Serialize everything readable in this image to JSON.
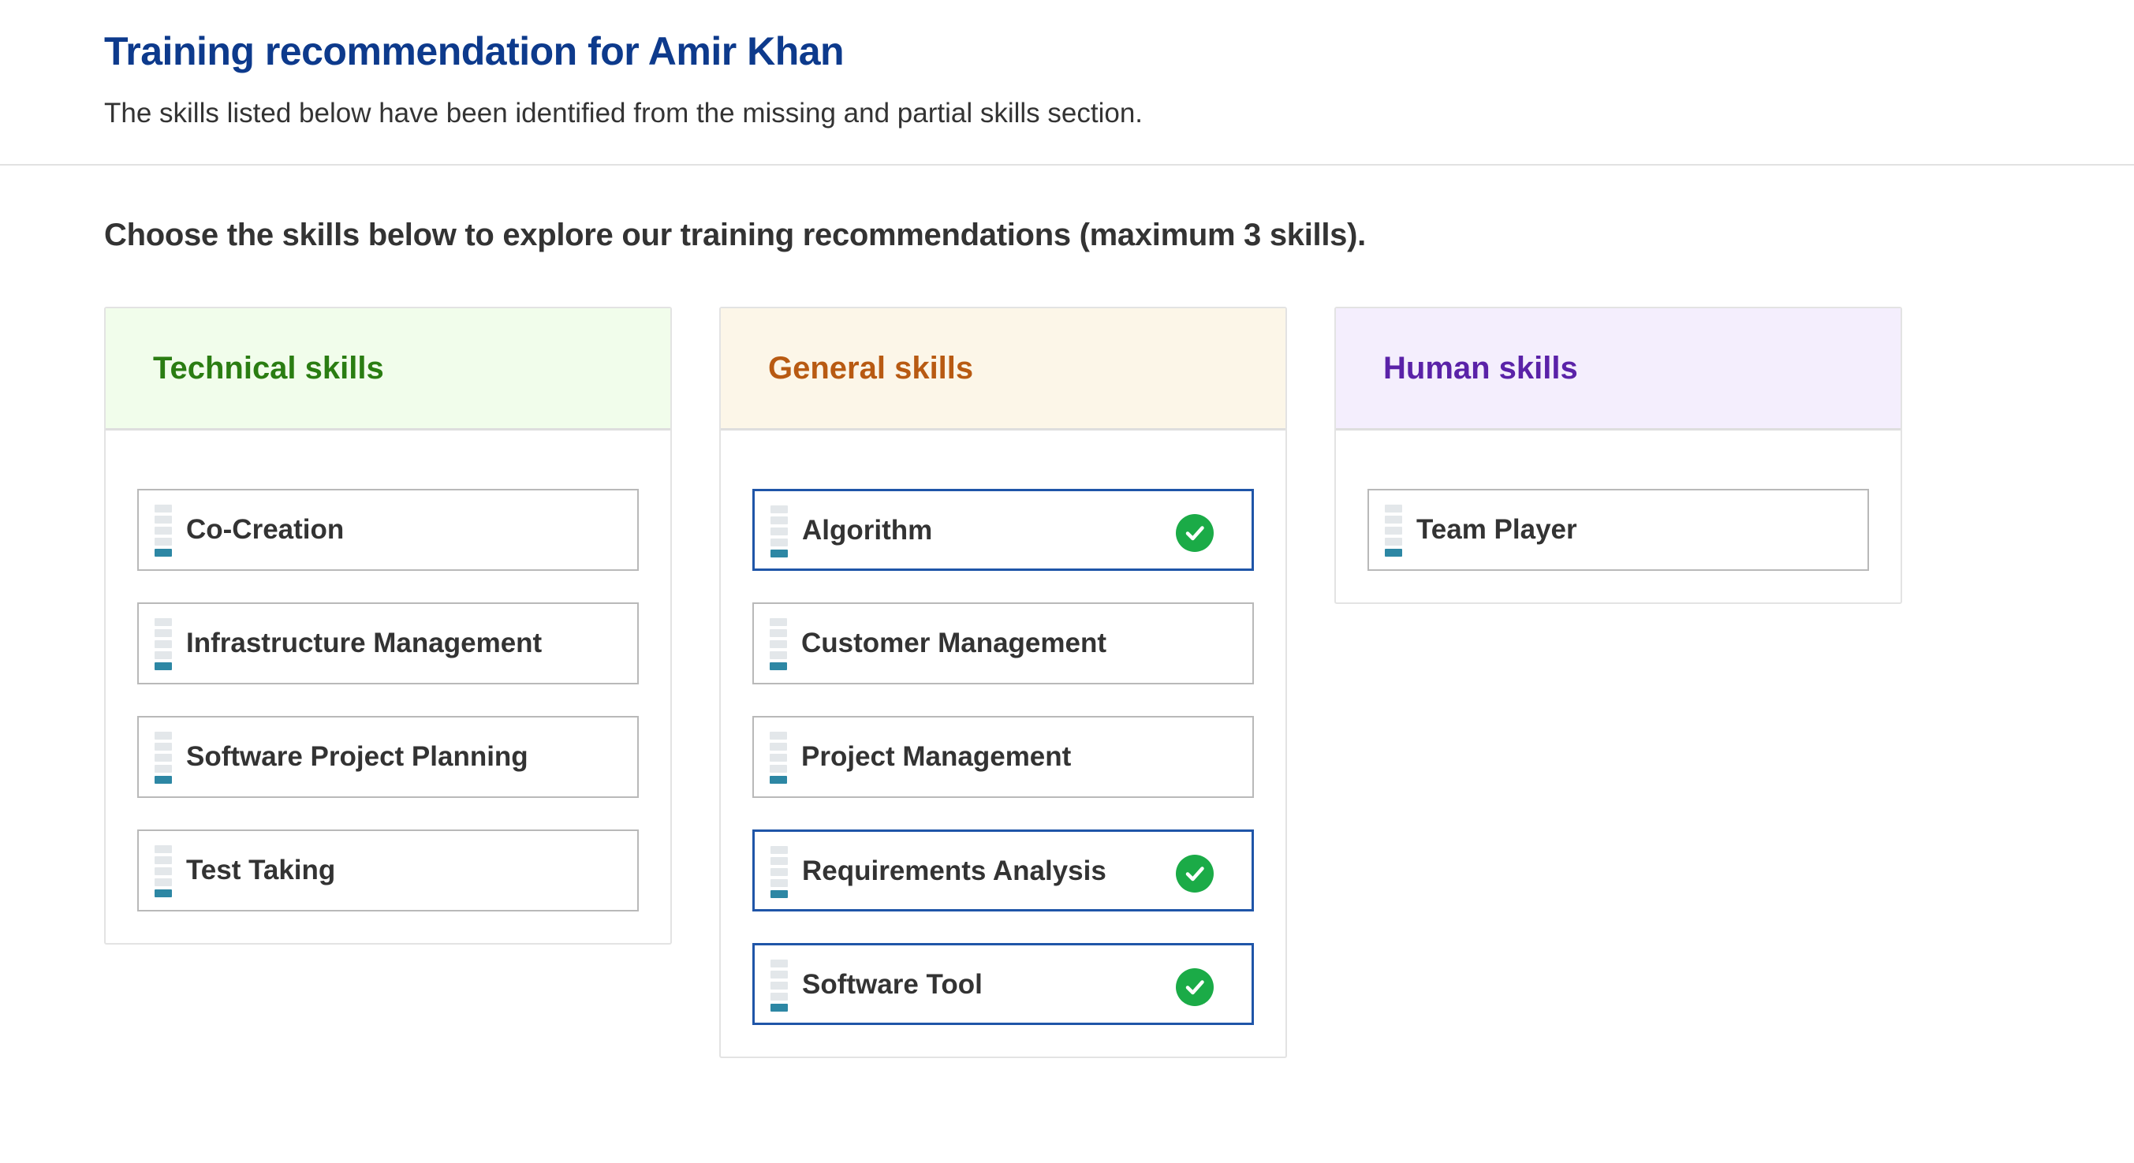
{
  "page": {
    "title": "Training recommendation for Amir Khan",
    "subtitle": "The skills listed below have been identified from the missing and partial skills section.",
    "instruction": "Choose the skills below to explore our training recommendations (maximum 3 skills)."
  },
  "colors": {
    "title": "#0d3a8c",
    "selected_border": "#1f55a8",
    "check": "#1bab47",
    "level_fill": "#2d87a4",
    "technical_header_bg": "#f1fdeb",
    "technical_title": "#2a7d12",
    "general_header_bg": "#fcf6e8",
    "general_title": "#b85a12",
    "human_header_bg": "#f4eefd",
    "human_title": "#5a22a8"
  },
  "icons": {
    "skill_level": "skill-level-icon",
    "selected": "check-circle-icon"
  },
  "categories": {
    "technical": {
      "title": "Technical skills",
      "skills": [
        {
          "label": "Co-Creation",
          "selected": false
        },
        {
          "label": "Infrastructure Management",
          "selected": false
        },
        {
          "label": "Software Project Planning",
          "selected": false
        },
        {
          "label": "Test Taking",
          "selected": false
        }
      ]
    },
    "general": {
      "title": "General skills",
      "skills": [
        {
          "label": "Algorithm",
          "selected": true
        },
        {
          "label": "Customer Management",
          "selected": false
        },
        {
          "label": "Project Management",
          "selected": false
        },
        {
          "label": "Requirements Analysis",
          "selected": true
        },
        {
          "label": "Software Tool",
          "selected": true
        }
      ]
    },
    "human": {
      "title": "Human skills",
      "skills": [
        {
          "label": "Team Player",
          "selected": false
        }
      ]
    }
  }
}
